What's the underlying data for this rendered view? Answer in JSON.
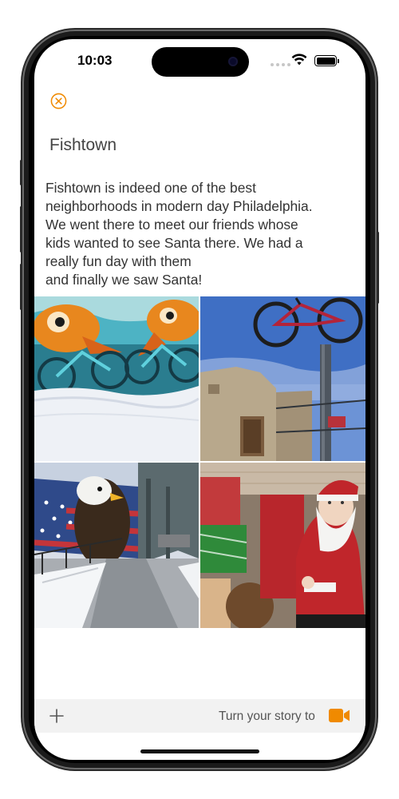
{
  "status": {
    "time": "10:03"
  },
  "note": {
    "title": "Fishtown",
    "body": "Fishtown is indeed one of the best\nneighborhoods in modern day Philadelphia.\nWe went there to meet our friends whose\nkids wanted to see Santa there. We had a\nreally fun day with them\nand finally we saw Santa!"
  },
  "photos": [
    {
      "name": "fish-bicycle-mural-photo"
    },
    {
      "name": "bicycle-on-pole-photo"
    },
    {
      "name": "eagle-flag-mural-photo"
    },
    {
      "name": "santa-claus-photo"
    }
  ],
  "toolbar": {
    "story_label": "Turn your story to"
  },
  "icons": {
    "close": "close-circle-icon",
    "add": "plus-icon",
    "video": "video-camera-icon",
    "wifi": "wifi-icon",
    "battery": "battery-icon"
  },
  "colors": {
    "accent": "#f08a00",
    "toolbar_bg": "#f2f2f2"
  }
}
